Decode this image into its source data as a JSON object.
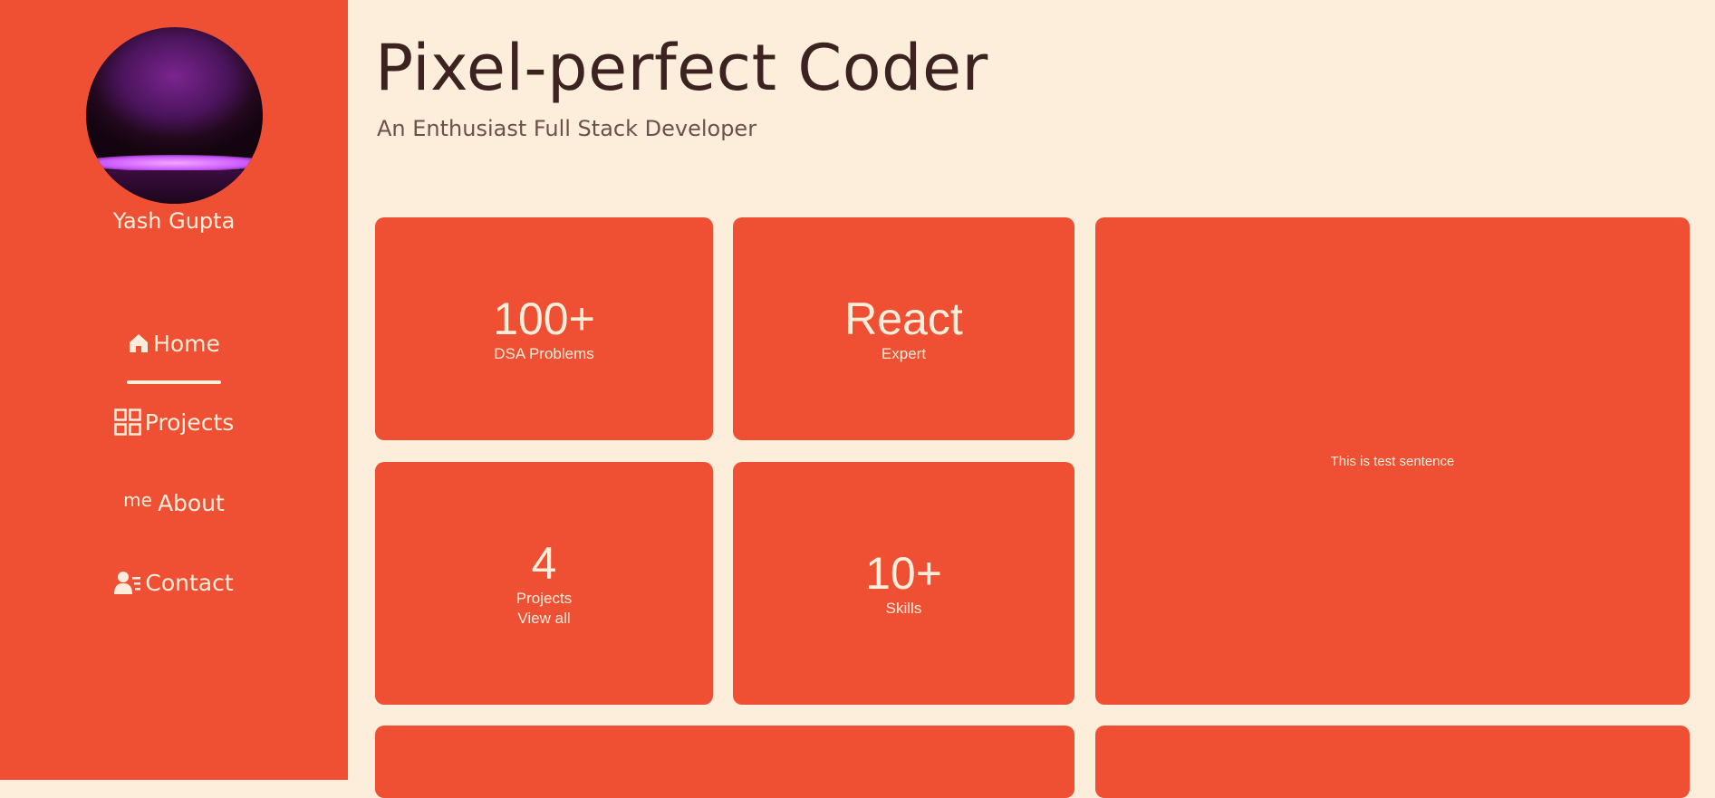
{
  "sidebar": {
    "user_name": "Yash Gupta",
    "nav": [
      {
        "label": "Home",
        "icon": "home-icon"
      },
      {
        "label": "Projects",
        "icon": "grid-icon"
      },
      {
        "label": "About",
        "icon_text": "me"
      },
      {
        "label": "Contact",
        "icon": "contact-icon"
      }
    ],
    "active": "Home"
  },
  "header": {
    "title": "Pixel-perfect Coder",
    "subtitle": "An Enthusiast Full Stack Developer"
  },
  "cards": {
    "dsa": {
      "value": "100+",
      "label": "DSA Problems"
    },
    "react": {
      "value": "React",
      "label": "Expert"
    },
    "projects": {
      "value": "4",
      "label": "Projects",
      "link": "View all"
    },
    "skills": {
      "value": "10+",
      "label": "Skills"
    },
    "test": {
      "text": "This is test sentence"
    }
  },
  "colors": {
    "accent": "#ef5034",
    "background": "#fdeddb",
    "text_dark": "#3c2320"
  }
}
